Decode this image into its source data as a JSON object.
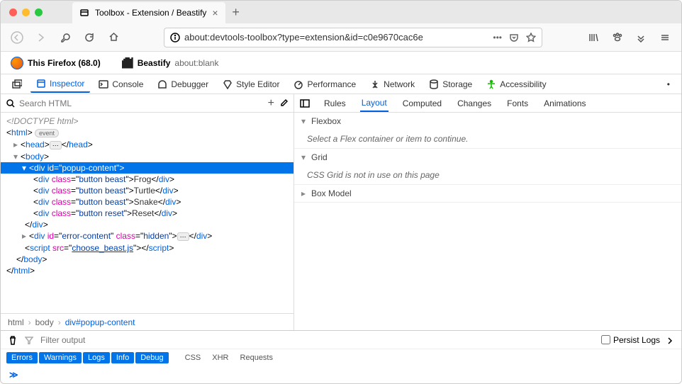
{
  "window": {
    "tab_title": "Toolbox - Extension / Beastify"
  },
  "url": "about:devtools-toolbox?type=extension&id=c0e9670cac6e",
  "ext_header": {
    "firefox_label": "This Firefox (68.0)",
    "ext_name": "Beastify",
    "ext_url": "about:blank"
  },
  "tools": {
    "inspector": "Inspector",
    "console": "Console",
    "debugger": "Debugger",
    "style": "Style Editor",
    "performance": "Performance",
    "network": "Network",
    "storage": "Storage",
    "accessibility": "Accessibility"
  },
  "search_placeholder": "Search HTML",
  "tree": {
    "doctype": "<!DOCTYPE html>",
    "html_open": "html",
    "event": "event",
    "head": "head",
    "body": "body",
    "popup_id": "popup-content",
    "beasts": [
      {
        "cls": "button beast",
        "txt": "Frog"
      },
      {
        "cls": "button beast",
        "txt": "Turtle"
      },
      {
        "cls": "button beast",
        "txt": "Snake"
      },
      {
        "cls": "button reset",
        "txt": "Reset"
      }
    ],
    "error_id": "error-content",
    "error_cls": "hidden",
    "script_src": "choose_beast.js"
  },
  "crumbs": {
    "c1": "html",
    "c2": "body",
    "c3": "div#popup-content"
  },
  "rtabs": {
    "rules": "Rules",
    "layout": "Layout",
    "computed": "Computed",
    "changes": "Changes",
    "fonts": "Fonts",
    "animations": "Animations"
  },
  "layout": {
    "flexbox": "Flexbox",
    "flexbox_msg": "Select a Flex container or item to continue.",
    "grid": "Grid",
    "grid_msg": "CSS Grid is not in use on this page",
    "boxmodel": "Box Model"
  },
  "console": {
    "filter_placeholder": "Filter output",
    "persist": "Persist Logs",
    "filters": {
      "errors": "Errors",
      "warnings": "Warnings",
      "logs": "Logs",
      "info": "Info",
      "debug": "Debug",
      "css": "CSS",
      "xhr": "XHR",
      "requests": "Requests"
    }
  }
}
